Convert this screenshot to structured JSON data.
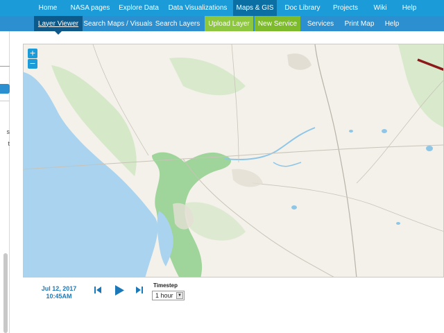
{
  "topnav": {
    "items": [
      "Home",
      "NASA pages",
      "Explore Data",
      "Data Visualizations",
      "Maps & GIS",
      "Doc Library",
      "Projects",
      "Wiki",
      "Help"
    ],
    "active_index": 4
  },
  "subnav": {
    "items": [
      "Layer Viewer",
      "Search Maps / Visuals",
      "Search Layers",
      "Upload Layer",
      "New Service",
      "Services",
      "Print Map",
      "Help"
    ],
    "active_index": 0
  },
  "map": {
    "zoom_in": "+",
    "zoom_out": "−",
    "colors": {
      "land": "#f3f1ea",
      "water": "#a9d3ee",
      "wetland": "#9fd49a",
      "park": "#c8e4b8",
      "route": "#8b1a1a"
    }
  },
  "timeline": {
    "date": "Jul 12, 2017",
    "time": "10:45AM",
    "timestep_label": "Timestep",
    "timestep_value": "1 hour",
    "icons": [
      "skip-back-icon",
      "play-icon",
      "skip-forward-icon"
    ]
  },
  "leftpanel": {
    "fragment_1": "s",
    "fragment_2": "t"
  }
}
